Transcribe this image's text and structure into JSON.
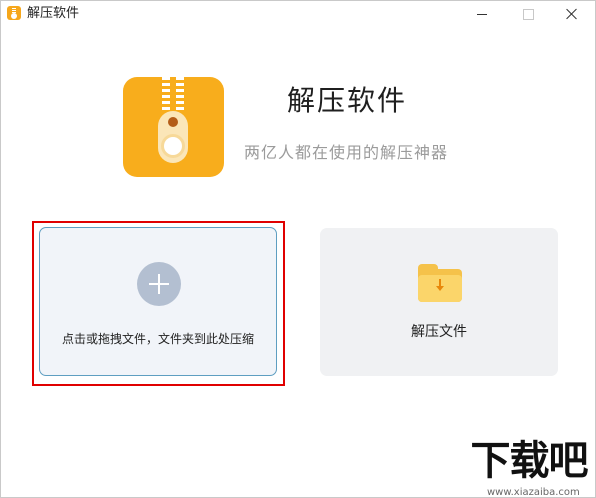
{
  "window": {
    "title": "解压软件",
    "controls": {
      "minimize": "minimize-icon",
      "maximize": "maximize-icon",
      "close": "close-icon"
    }
  },
  "header": {
    "logo_icon": "zipper-archive-icon",
    "app_name": "解压软件",
    "tagline": "两亿人都在使用的解压神器"
  },
  "cards": {
    "compress": {
      "icon": "plus-icon",
      "label": "点击或拖拽文件，文件夹到此处压缩",
      "highlighted": true
    },
    "extract": {
      "icon": "folder-download-icon",
      "label": "解压文件"
    }
  },
  "watermark": {
    "logo_text": "下载吧",
    "url": "www.xiazaiba.com"
  },
  "colors": {
    "brand_orange": "#f8ad1c",
    "highlight_red": "#e00000",
    "card_border_blue": "#5e9ec1",
    "compress_card_bg": "#f1f4f9",
    "extract_card_bg": "#f0f1f3"
  }
}
